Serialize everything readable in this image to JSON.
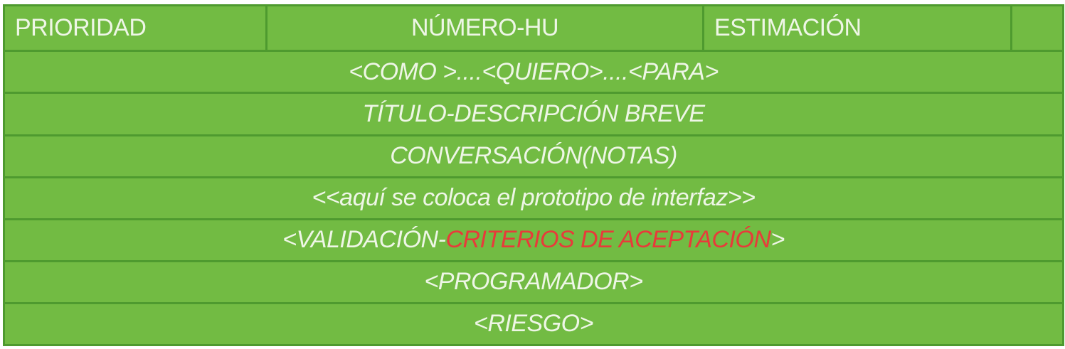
{
  "header": {
    "priority": "PRIORIDAD",
    "number": "NÚMERO-HU",
    "estimate": "ESTIMACIÓN",
    "extra": ""
  },
  "rows": {
    "story": "<COMO >....<QUIERO>....<PARA>",
    "title": "TÍTULO-DESCRIPCIÓN BREVE",
    "conversation": "CONVERSACIÓN(NOTAS)",
    "prototype": "<<aquí se coloca el prototipo de interfaz>>",
    "validation": {
      "prefix": "<VALIDACIÓN-",
      "criteria": "CRITERIOS DE ACEPTACIÓN",
      "suffix": ">"
    },
    "programmer": "<PROGRAMADOR>",
    "risk": "<RIESGO>"
  },
  "colors": {
    "background": "#72bb43",
    "border": "#4e9a2f",
    "text": "#eef6e6",
    "accent": "#e83a3a"
  }
}
